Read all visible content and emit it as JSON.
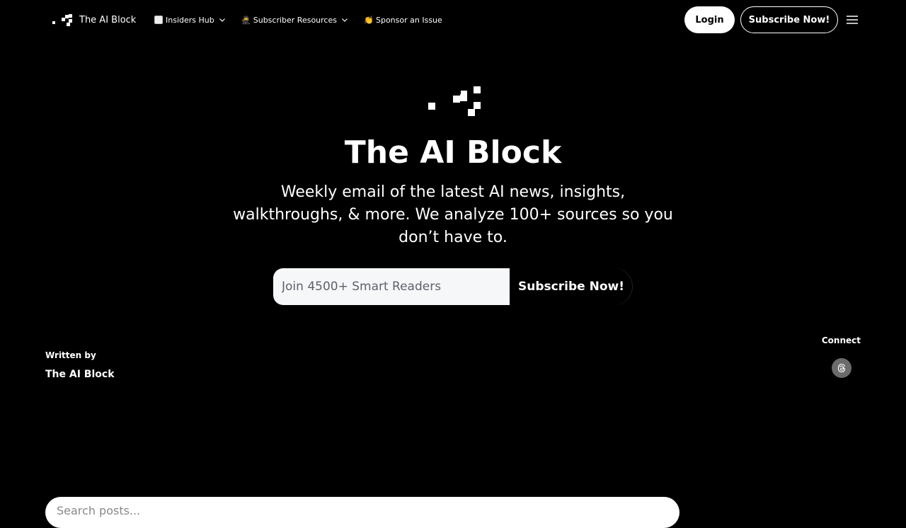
{
  "header": {
    "brand_name": "The AI Block",
    "nav": [
      {
        "emoji": "⬜",
        "label": "Insiders Hub",
        "has_dropdown": true
      },
      {
        "emoji": "🥷",
        "label": "Subscriber Resources",
        "has_dropdown": true
      },
      {
        "emoji": "👏",
        "label": "Sponsor an Issue",
        "has_dropdown": false
      }
    ],
    "login_label": "Login",
    "subscribe_label": "Subscribe Now!",
    "menu_icon": "hamburger-menu-icon"
  },
  "hero": {
    "title": "The AI Block",
    "description": "Weekly email of the latest AI news, insights, walkthroughs, & more. We analyze 100+ sources so you don’t have to.",
    "email_placeholder": "Join 4500+ Smart Readers",
    "subscribe_label": "Subscribe Now!"
  },
  "meta": {
    "written_by_label": "Written by",
    "author": "The AI Block",
    "connect_label": "Connect",
    "social_icon": "threads-icon"
  },
  "search": {
    "placeholder": "Search posts..."
  },
  "colors": {
    "background": "#000000",
    "text": "#ffffff",
    "input_bg": "#f6f7f9",
    "social_bg": "#6b6b6b"
  }
}
